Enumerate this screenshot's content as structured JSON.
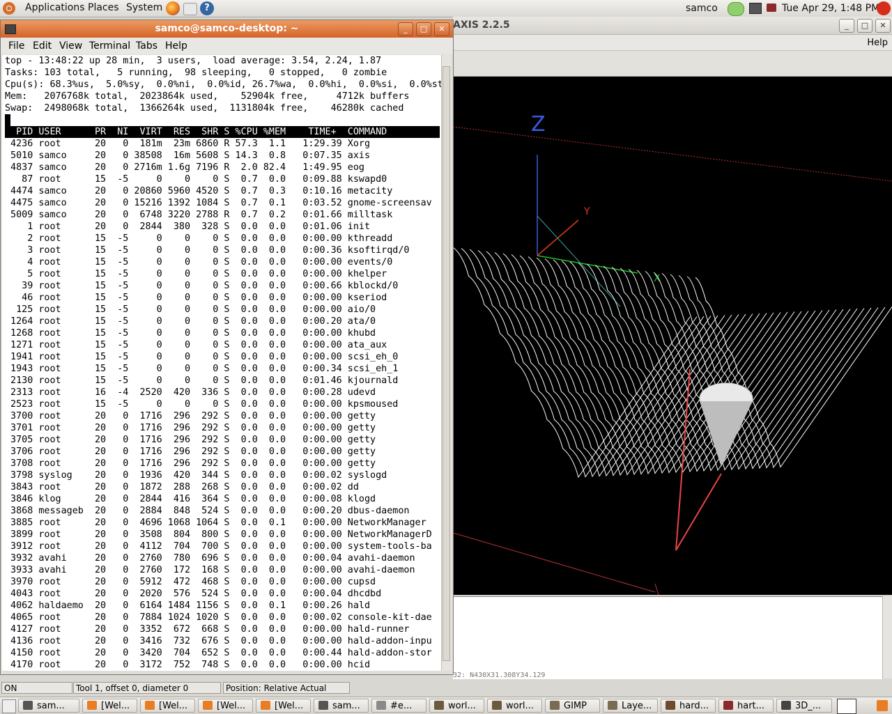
{
  "top_panel": {
    "menus": [
      "Applications",
      "Places",
      "System"
    ],
    "user": "samco",
    "datetime": "Tue Apr 29,  1:48 PM"
  },
  "axis": {
    "title": "AXIS 2.2.5",
    "help_label": "Help",
    "gcode_line": "32: N430X31.308Y34.129",
    "status_mode": "ON",
    "status_tool": "Tool 1, offset 0, diameter 0",
    "status_position": "Position: Relative Actual",
    "axis_labels": {
      "z": "Z",
      "y": "Y",
      "x": "X"
    }
  },
  "terminal": {
    "title": "samco@samco-desktop: ~",
    "menus": [
      "File",
      "Edit",
      "View",
      "Terminal",
      "Tabs",
      "Help"
    ],
    "summary": [
      "top - 13:48:22 up 28 min,  3 users,  load average: 3.54, 2.24, 1.87",
      "Tasks: 103 total,   5 running,  98 sleeping,   0 stopped,   0 zombie",
      "Cpu(s): 68.3%us,  5.0%sy,  0.0%ni,  0.0%id, 26.7%wa,  0.0%hi,  0.0%si,  0.0%st",
      "Mem:   2076768k total,  2023864k used,    52904k free,     4712k buffers",
      "Swap:  2498068k total,  1366264k used,  1131804k free,    46280k cached"
    ],
    "header": "  PID USER      PR  NI  VIRT  RES  SHR S %CPU %MEM    TIME+  COMMAND",
    "processes": [
      " 4236 root      20   0  181m  23m 6860 R 57.3  1.1   1:29.39 Xorg",
      " 5010 samco     20   0 38508  16m 5608 S 14.3  0.8   0:07.35 axis",
      " 4837 samco     20   0 2716m 1.6g 7196 R  2.0 82.4   1:49.95 eog",
      "   87 root      15  -5     0    0    0 S  0.7  0.0   0:09.88 kswapd0",
      " 4474 samco     20   0 20860 5960 4520 S  0.7  0.3   0:10.16 metacity",
      " 4475 samco     20   0 15216 1392 1084 S  0.7  0.1   0:03.52 gnome-screensav",
      " 5009 samco     20   0  6748 3220 2788 R  0.7  0.2   0:01.66 milltask",
      "    1 root      20   0  2844  380  328 S  0.0  0.0   0:01.06 init",
      "    2 root      15  -5     0    0    0 S  0.0  0.0   0:00.00 kthreadd",
      "    3 root      15  -5     0    0    0 S  0.0  0.0   0:00.36 ksoftirqd/0",
      "    4 root      15  -5     0    0    0 S  0.0  0.0   0:00.00 events/0",
      "    5 root      15  -5     0    0    0 S  0.0  0.0   0:00.00 khelper",
      "   39 root      15  -5     0    0    0 S  0.0  0.0   0:00.66 kblockd/0",
      "   46 root      15  -5     0    0    0 S  0.0  0.0   0:00.00 kseriod",
      "  125 root      15  -5     0    0    0 S  0.0  0.0   0:00.00 aio/0",
      " 1264 root      15  -5     0    0    0 S  0.0  0.0   0:00.20 ata/0",
      " 1268 root      15  -5     0    0    0 S  0.0  0.0   0:00.00 khubd",
      " 1271 root      15  -5     0    0    0 S  0.0  0.0   0:00.00 ata_aux",
      " 1941 root      15  -5     0    0    0 S  0.0  0.0   0:00.00 scsi_eh_0",
      " 1943 root      15  -5     0    0    0 S  0.0  0.0   0:00.34 scsi_eh_1",
      " 2130 root      15  -5     0    0    0 S  0.0  0.0   0:01.46 kjournald",
      " 2313 root      16  -4  2520  420  336 S  0.0  0.0   0:00.28 udevd",
      " 2523 root      15  -5     0    0    0 S  0.0  0.0   0:00.00 kpsmoused",
      " 3700 root      20   0  1716  296  292 S  0.0  0.0   0:00.00 getty",
      " 3701 root      20   0  1716  296  292 S  0.0  0.0   0:00.00 getty",
      " 3705 root      20   0  1716  296  292 S  0.0  0.0   0:00.00 getty",
      " 3706 root      20   0  1716  296  292 S  0.0  0.0   0:00.00 getty",
      " 3708 root      20   0  1716  296  292 S  0.0  0.0   0:00.00 getty",
      " 3798 syslog    20   0  1936  420  344 S  0.0  0.0   0:00.02 syslogd",
      " 3843 root      20   0  1872  288  268 S  0.0  0.0   0:00.02 dd",
      " 3846 klog      20   0  2844  416  364 S  0.0  0.0   0:00.08 klogd",
      " 3868 messageb  20   0  2884  848  524 S  0.0  0.0   0:00.20 dbus-daemon",
      " 3885 root      20   0  4696 1068 1064 S  0.0  0.1   0:00.00 NetworkManager",
      " 3899 root      20   0  3508  804  800 S  0.0  0.0   0:00.00 NetworkManagerD",
      " 3912 root      20   0  4112  704  700 S  0.0  0.0   0:00.00 system-tools-ba",
      " 3932 avahi     20   0  2760  780  696 S  0.0  0.0   0:00.04 avahi-daemon",
      " 3933 avahi     20   0  2760  172  168 S  0.0  0.0   0:00.00 avahi-daemon",
      " 3970 root      20   0  5912  472  468 S  0.0  0.0   0:00.00 cupsd",
      " 4043 root      20   0  2020  576  524 S  0.0  0.0   0:00.04 dhcdbd",
      " 4062 haldaemo  20   0  6164 1484 1156 S  0.0  0.1   0:00.26 hald",
      " 4065 root      20   0  7884 1024 1020 S  0.0  0.0   0:00.02 console-kit-dae",
      " 4127 root      20   0  3352  672  668 S  0.0  0.0   0:00.00 hald-runner",
      " 4136 root      20   0  3416  732  676 S  0.0  0.0   0:00.00 hald-addon-inpu",
      " 4150 root      20   0  3420  704  652 S  0.0  0.0   0:00.44 hald-addon-stor",
      " 4170 root      20   0  3172  752  748 S  0.0  0.0   0:00.00 hcid"
    ]
  },
  "taskbar": [
    {
      "label": "sam...",
      "icon": "terminal-icon",
      "color": "#555"
    },
    {
      "label": "[Wel...",
      "icon": "firefox-icon",
      "color": "#e87d24"
    },
    {
      "label": "[Wel...",
      "icon": "firefox-icon",
      "color": "#e87d24"
    },
    {
      "label": "[Wel...",
      "icon": "firefox-icon",
      "color": "#e87d24"
    },
    {
      "label": "[Wel...",
      "icon": "firefox-icon",
      "color": "#e87d24"
    },
    {
      "label": "sam...",
      "icon": "terminal-icon",
      "color": "#555"
    },
    {
      "label": "#e...",
      "icon": "chat-icon",
      "color": "#8a8a8a"
    },
    {
      "label": "worl...",
      "icon": "image-icon",
      "color": "#6b5a3e"
    },
    {
      "label": "worl...",
      "icon": "image-icon",
      "color": "#6b5a3e"
    },
    {
      "label": "GIMP",
      "icon": "gimp-icon",
      "color": "#7a6b55"
    },
    {
      "label": "Laye...",
      "icon": "gimp-icon",
      "color": "#7a6b55"
    },
    {
      "label": "hard...",
      "icon": "document-icon",
      "color": "#6d4a30"
    },
    {
      "label": "hart...",
      "icon": "document-icon",
      "color": "#8b2a2a"
    },
    {
      "label": "3D_...",
      "icon": "axis-icon",
      "color": "#444"
    }
  ]
}
